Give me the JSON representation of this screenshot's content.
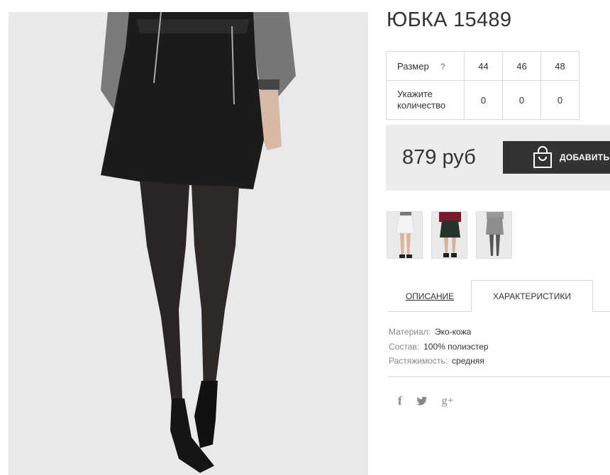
{
  "product": {
    "title": "ЮБКА 15489"
  },
  "size_table": {
    "size_label": "Размер",
    "help_mark": "?",
    "sizes": [
      "44",
      "46",
      "48"
    ],
    "quantity_label_1": "Укажите",
    "quantity_label_2": "количество",
    "quantities": [
      "0",
      "0",
      "0"
    ]
  },
  "price_box": {
    "price": "879 руб",
    "add_button_label": "ДОБАВИТЬ",
    "button_icon": "shopping-bag-icon"
  },
  "tabs": [
    {
      "label": "ОПИСАНИЕ"
    },
    {
      "label": "ХАРАКТЕРИСТИКИ"
    }
  ],
  "characteristics": [
    {
      "key": "Материал:",
      "value": "Эко-кожа"
    },
    {
      "key": "Состав:",
      "value": "100% полиэстер"
    },
    {
      "key": "Растяжимость:",
      "value": "средняя"
    }
  ],
  "social": {
    "facebook": "f",
    "twitter": "🐦",
    "google_plus": "g+"
  },
  "colors": {
    "accent_dark": "#333333",
    "price_box_bg": "#ececec",
    "border": "#d8d8d8"
  }
}
